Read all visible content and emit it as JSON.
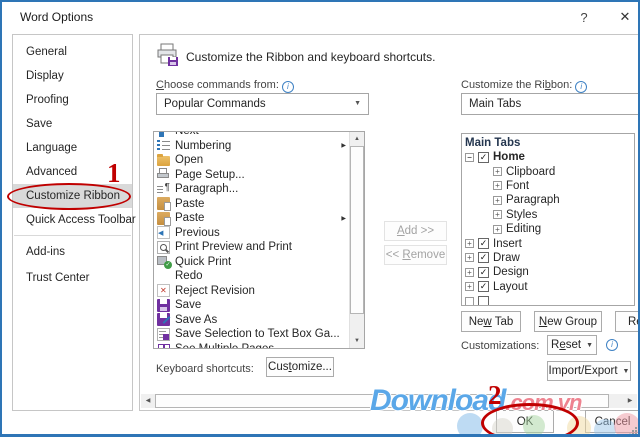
{
  "window": {
    "title": "Word Options"
  },
  "icons": {
    "help": "?",
    "close": "✕",
    "combo_arrow": "▼",
    "menu_arrow": "▼",
    "submenu": "▶",
    "scroll_up": "▲",
    "scroll_down": "▼",
    "scroll_left": "◀",
    "scroll_right": "▶",
    "check": "✓",
    "collapse": "−",
    "expand": "+",
    "info": "i"
  },
  "colors": {
    "accent_blue": "#2e75b6",
    "annotation_red": "#c00000",
    "save_purple": "#7030a0"
  },
  "annotations": {
    "step1": "1",
    "step2": "2"
  },
  "sidebar": {
    "items": [
      "General",
      "Display",
      "Proofing",
      "Save",
      "Language",
      "Advanced",
      "Customize Ribbon",
      "Quick Access Toolbar",
      "Add-ins",
      "Trust Center"
    ],
    "selected": "Customize Ribbon"
  },
  "main": {
    "header": "Customize the Ribbon and keyboard shortcuts.",
    "choose_label": {
      "u": "C",
      "post": "hoose commands from:"
    },
    "choose_value": "Popular Commands",
    "customize_label": {
      "pre": "Customize the Ri",
      "u": "b",
      "post": "bon:"
    },
    "customize_value": "Main Tabs",
    "commands": [
      {
        "label": "Next"
      },
      {
        "label": "Numbering"
      },
      {
        "label": "Open"
      },
      {
        "label": "Page Setup..."
      },
      {
        "label": "Paragraph..."
      },
      {
        "label": "Paste"
      },
      {
        "label": "Paste"
      },
      {
        "label": "Previous"
      },
      {
        "label": "Print Preview and Print"
      },
      {
        "label": "Quick Print"
      },
      {
        "label": "Redo"
      },
      {
        "label": "Reject Revision"
      },
      {
        "label": "Save"
      },
      {
        "label": "Save As"
      },
      {
        "label": "Save Selection to Text Box Ga..."
      },
      {
        "label": "See Multiple Pages"
      }
    ],
    "add_button": {
      "u": "A",
      "post": "dd >>"
    },
    "remove_button": {
      "pre": "<< ",
      "u": "R",
      "post": "emove"
    },
    "tree": {
      "header": "Main Tabs",
      "home": {
        "label": "Home",
        "groups": [
          "Clipboard",
          "Font",
          "Paragraph",
          "Styles",
          "Editing"
        ]
      },
      "tabs": [
        "Insert",
        "Draw",
        "Design",
        "Layout"
      ]
    },
    "new_tab_button": {
      "pre": "Ne",
      "u": "w",
      "post": " Tab"
    },
    "new_group_button": {
      "u": "N",
      "post": "ew Group"
    },
    "rename_button": "Re",
    "customizations_label": "Customizations:",
    "reset_button": {
      "pre": "R",
      "u": "e",
      "post": "set"
    },
    "import_export_button": "Import/Export",
    "keyboard_label": "Keyboard shortcuts:",
    "keyboard_customize_button": {
      "pre": "Cus",
      "u": "t",
      "post": "omize..."
    }
  },
  "footer": {
    "ok": "OK",
    "cancel": "Cancel"
  },
  "watermark": {
    "part1": "Download",
    "part2": ".com.vn"
  }
}
